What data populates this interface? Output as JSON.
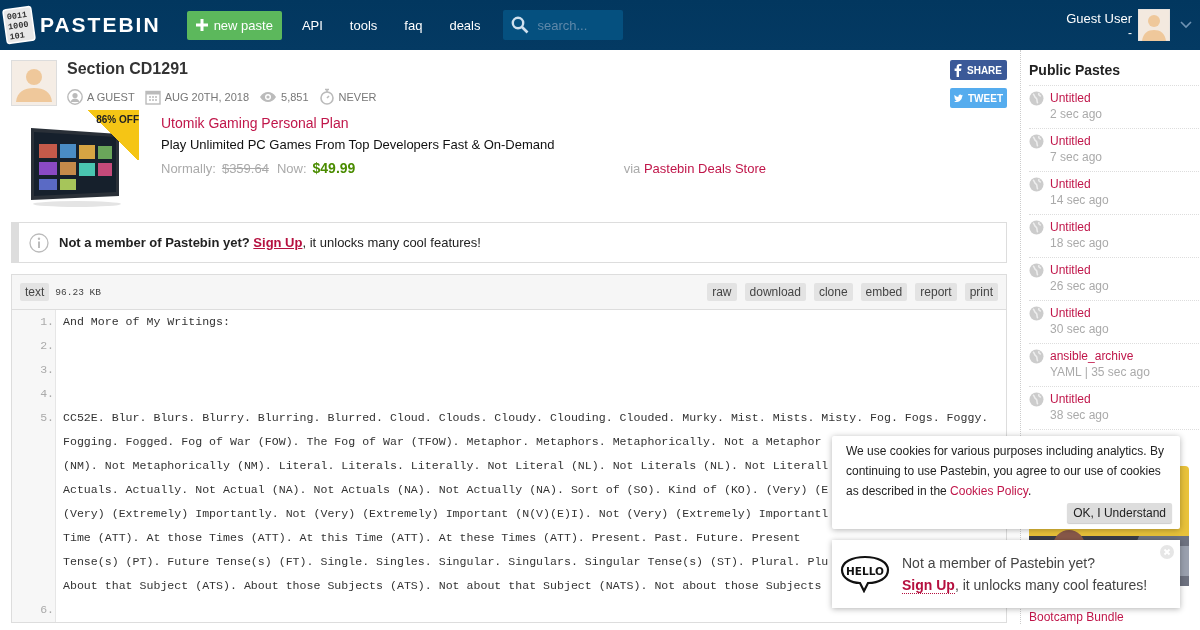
{
  "header": {
    "logo_digits": [
      "0011",
      "1000",
      "101"
    ],
    "logo": "PASTEBIN",
    "new_paste": "new paste",
    "nav": [
      "API",
      "tools",
      "faq",
      "deals"
    ],
    "search": {
      "placeholder": "search..."
    },
    "user": {
      "name": "Guest User",
      "sub": "-"
    }
  },
  "paste": {
    "title": "Section CD1291",
    "meta": [
      {
        "kind": "user",
        "text": "A GUEST"
      },
      {
        "kind": "date",
        "text": "AUG 20TH, 2018"
      },
      {
        "kind": "views",
        "text": "5,851"
      },
      {
        "kind": "expiry",
        "text": "NEVER"
      }
    ],
    "share": [
      {
        "kind": "facebook",
        "label": "SHARE"
      },
      {
        "kind": "twitter",
        "label": "TWEET"
      }
    ]
  },
  "deal": {
    "badge": "86% OFF",
    "title": "Utomik Gaming Personal Plan",
    "description": "Play Unlimited PC Games From Top Developers Fast & On-Demand",
    "normally_label": "Normally:",
    "old_price": "$359.64",
    "now_label": "Now:",
    "price": "$49.99",
    "via": "via",
    "store": "Pastebin Deals Store"
  },
  "notice": {
    "lead": "Not a member of Pastebin yet?",
    "link": "Sign Up",
    "rest": ", it unlocks many cool features!"
  },
  "code": {
    "syntax": "text",
    "size": "96.23 KB",
    "actions": [
      "raw",
      "download",
      "clone",
      "embed",
      "report",
      "print"
    ],
    "lines": [
      {
        "number": "1.",
        "rows": [
          "And More of My Writings:"
        ]
      },
      {
        "number": "2."
      },
      {
        "number": "3."
      },
      {
        "number": "4."
      },
      {
        "number": "5.",
        "rows": [
          "CC52E. Blur. Blurs. Blurry. Blurring. Blurred. Cloud. Clouds. Cloudy. Clouding. Clouded. Murky. Mist. Mists. Misty. Fog. Fogs. Foggy.",
          "Fogging. Fogged. Fog of War (FOW). The Fog of War (TFOW). Metaphor. Metaphors. Metaphorically. Not a Metaphor",
          "(NM). Not Metaphorically (NM). Literal. Literals. Literally. Not Literal (NL). Not Literals (NL). Not Literall",
          "Actuals. Actually. Not Actual (NA). Not Actuals (NA). Not Actually (NA). Sort of (SO). Kind of (KO). (Very) (E",
          "(Very) (Extremely) Importantly. Not (Very) (Extremely) Important (N(V)(E)I). Not (Very) (Extremely) Importantl",
          "Time (ATT). At those Times (ATT). At this Time (ATT). At these Times (ATT). Present. Past. Future. Present",
          "Tense(s) (PT). Future Tense(s) (FT). Single. Singles. Singular. Singulars. Singular Tense(s) (ST). Plural. Plu",
          "About that Subject (ATS). About those Subjects (ATS). Not about that Subject (NATS). Not about those Subjects"
        ]
      },
      {
        "number": "6."
      }
    ]
  },
  "sidebar": {
    "title": "Public Pastes",
    "items": [
      {
        "title": "Untitled",
        "info": "2 sec ago"
      },
      {
        "title": "Untitled",
        "info": "7 sec ago"
      },
      {
        "title": "Untitled",
        "info": "14 sec ago"
      },
      {
        "title": "Untitled",
        "info": "18 sec ago"
      },
      {
        "title": "Untitled",
        "info": "26 sec ago"
      },
      {
        "title": "Untitled",
        "info": "30 sec ago"
      },
      {
        "title": "ansible_archive",
        "info": "YAML | 35 sec ago"
      },
      {
        "title": "Untitled",
        "info": "38 sec ago"
      }
    ],
    "ad_title": "Bootcamp Bundle"
  },
  "cookie": {
    "text": "We use cookies for various purposes including analytics. By continuing to use Pastebin, you agree to our use of cookies as described in the",
    "link": "Cookies Policy",
    "after": ".",
    "button": "OK, I Understand"
  },
  "hello": {
    "bubble": "HELLO",
    "lead": "Not a member of Pastebin yet?",
    "link": "Sign Up",
    "rest": ", it unlocks many cool features!"
  }
}
